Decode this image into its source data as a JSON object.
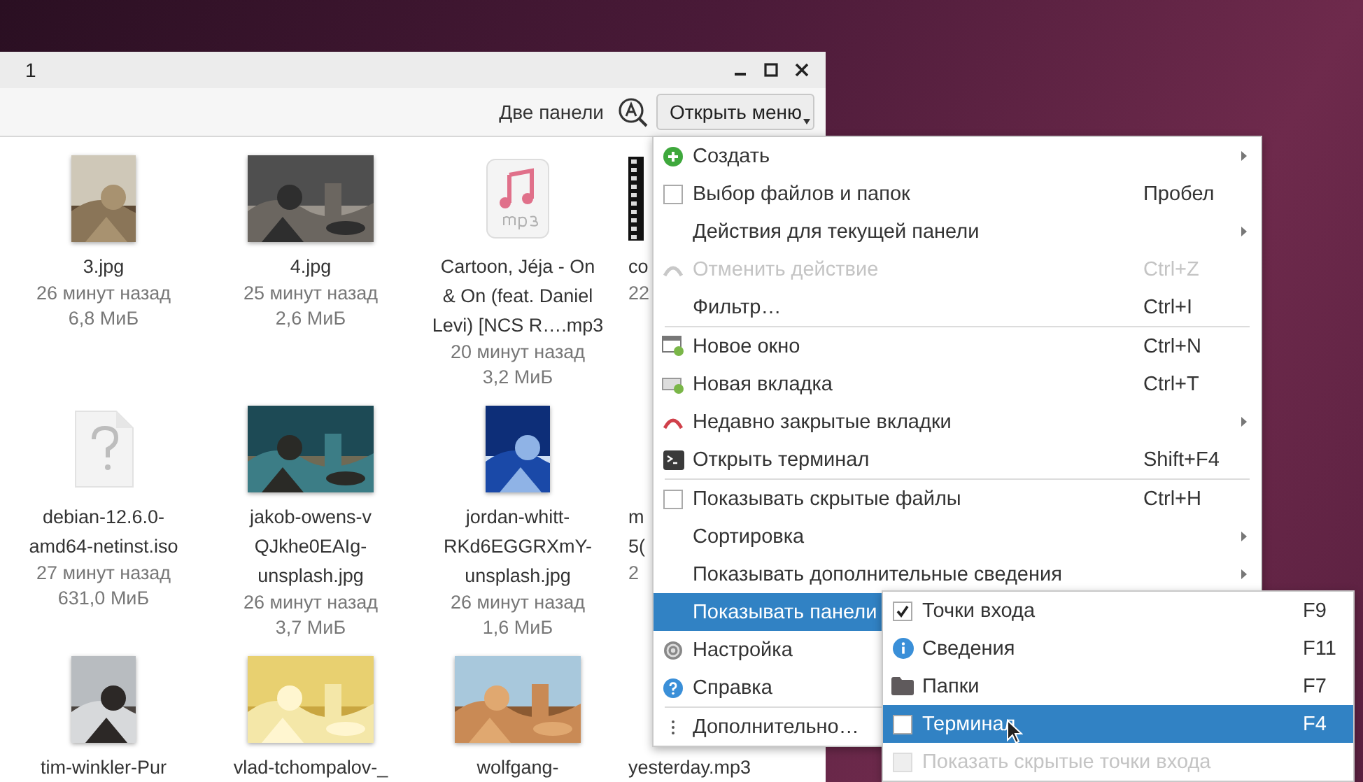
{
  "window": {
    "title": "1"
  },
  "toolbar": {
    "dual_pane_label": "Две панели",
    "menu_button": "Открыть меню"
  },
  "files": [
    {
      "name_lines": [
        "3.jpg"
      ],
      "date": "26 минут назад",
      "size": "6,8 МиБ",
      "kind": "portrait"
    },
    {
      "name_lines": [
        "4.jpg"
      ],
      "date": "25 минут назад",
      "size": "2,6 МиБ",
      "kind": "landscape"
    },
    {
      "name_lines": [
        "Cartoon, Jéja - On",
        "& On (feat. Daniel",
        "Levi) [NCS R….mp3"
      ],
      "date": "20 минут назад",
      "size": "3,2 МиБ",
      "kind": "audio"
    },
    {
      "name_lines": [
        "co"
      ],
      "date": "22",
      "kind": "video"
    },
    {
      "name_lines": [
        "debian-12.6.0-",
        "amd64-netinst.iso"
      ],
      "date": "27 минут назад",
      "size": "631,0 МиБ",
      "kind": "unknown"
    },
    {
      "name_lines": [
        "jakob-owens-v",
        "QJkhe0EAIg-",
        "unsplash.jpg"
      ],
      "date": "26 минут назад",
      "size": "3,7 МиБ",
      "kind": "landscape"
    },
    {
      "name_lines": [
        "jordan-whitt-",
        "RKd6EGGRXmY-",
        "unsplash.jpg"
      ],
      "date": "26 минут назад",
      "size": "1,6 МиБ",
      "kind": "portrait"
    },
    {
      "name_lines": [
        "m",
        "5("
      ],
      "date": "2"
    },
    {
      "name_lines": [
        "tim-winkler-Pur"
      ],
      "kind": "portrait"
    },
    {
      "name_lines": [
        "vlad-tchompalov-_"
      ],
      "kind": "landscape"
    },
    {
      "name_lines": [
        "wolfgang-"
      ],
      "kind": "landscape"
    },
    {
      "name_lines": [
        "yesterday.mp3"
      ]
    }
  ],
  "menu": [
    {
      "kind": "add",
      "label": "Создать",
      "submenu": true
    },
    {
      "kind": "check",
      "label": "Выбор файлов и папок",
      "shortcut": "Пробел",
      "checked": false
    },
    {
      "kind": "plain",
      "label": "Действия для текущей панели",
      "submenu": true
    },
    {
      "kind": "undo",
      "label": "Отменить действие",
      "shortcut": "Ctrl+Z",
      "disabled": true
    },
    {
      "kind": "plain",
      "label": "Фильтр…",
      "shortcut": "Ctrl+I"
    },
    {
      "kind": "window",
      "label": "Новое окно",
      "shortcut": "Ctrl+N",
      "separator_before": true
    },
    {
      "kind": "tab",
      "label": "Новая вкладка",
      "shortcut": "Ctrl+T"
    },
    {
      "kind": "history",
      "label": "Недавно закрытые вкладки",
      "submenu": true
    },
    {
      "kind": "terminal",
      "label": "Открыть терминал",
      "shortcut": "Shift+F4"
    },
    {
      "kind": "check",
      "label": "Показывать скрытые файлы",
      "shortcut": "Ctrl+H",
      "checked": false,
      "separator_before": true
    },
    {
      "kind": "plain",
      "label": "Сортировка",
      "submenu": true
    },
    {
      "kind": "plain",
      "label": "Показывать дополнительные сведения",
      "submenu": true
    },
    {
      "kind": "plain",
      "label": "Показывать панели",
      "selected": true
    },
    {
      "kind": "settings",
      "label": "Настройка"
    },
    {
      "kind": "help",
      "label": "Справка"
    },
    {
      "kind": "more",
      "label": "Дополнительно…",
      "separator_before": true
    }
  ],
  "submenu": [
    {
      "kind": "check",
      "label": "Точки входа",
      "shortcut": "F9",
      "checked": true
    },
    {
      "kind": "info",
      "label": "Сведения",
      "shortcut": "F11"
    },
    {
      "kind": "folder",
      "label": "Папки",
      "shortcut": "F7"
    },
    {
      "kind": "check",
      "label": "Терминал",
      "shortcut": "F4",
      "checked": false,
      "selected": true
    },
    {
      "kind": "check",
      "label": "Показать скрытые точки входа",
      "checked": false,
      "disabled": true
    }
  ]
}
